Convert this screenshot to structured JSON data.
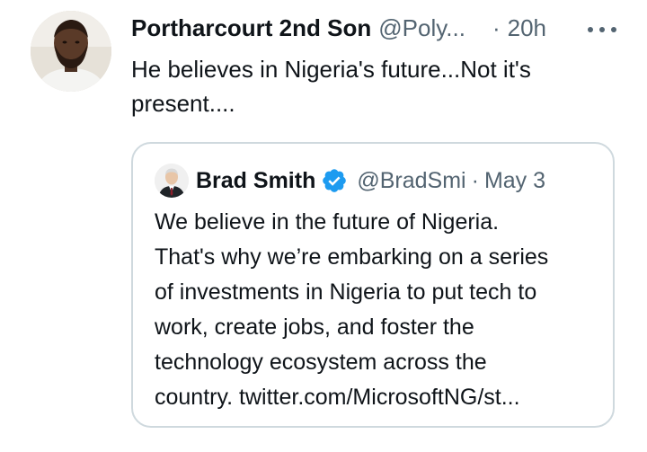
{
  "tweet": {
    "display_name": "Portharcourt 2nd Son",
    "handle": "@Poly...",
    "dot": "·",
    "time": "20h",
    "more_icon": "more-horizontal-icon",
    "text_lines": [
      "He believes in Nigeria's future...Not it's",
      "present...."
    ]
  },
  "quoted_tweet": {
    "display_name": "Brad Smith",
    "verified_icon": "verified-badge-icon",
    "verified_color": "#1d9bf0",
    "handle": "@BradSmi",
    "dot": "·",
    "date": "May 3",
    "text_lines": [
      "We believe in the future of Nigeria.",
      "That's why we’re embarking on a series",
      "of investments in Nigeria to put tech to",
      "work, create jobs, and foster the",
      "technology ecosystem across the",
      "country. twitter.com/MicrosoftNG/st..."
    ]
  },
  "colors": {
    "text_primary": "#0f1419",
    "text_secondary": "#536471",
    "border": "#cfd9de",
    "background": "#ffffff"
  }
}
